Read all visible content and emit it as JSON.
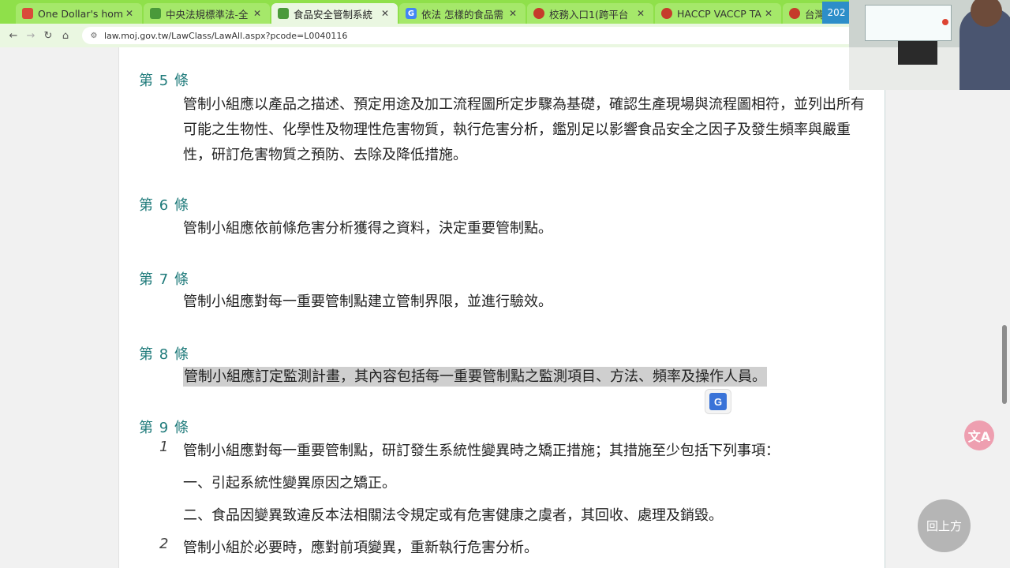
{
  "tabs": [
    {
      "title": "One Dollar's hom",
      "favicon": "red-square-icon",
      "color": "#d94a3a",
      "active": false
    },
    {
      "title": "中央法規標準法-全",
      "favicon": "green-leaf-icon",
      "color": "#4a9a3a",
      "active": false
    },
    {
      "title": "食品安全管制系統",
      "favicon": "green-leaf-icon",
      "color": "#4a9a3a",
      "active": true
    },
    {
      "title": "依法 怎樣的食品需",
      "favicon": "google-g-icon",
      "color": "#4285f4",
      "active": false
    },
    {
      "title": "校務入口1(跨平台",
      "favicon": "red-circle-icon",
      "color": "#c53b2b",
      "active": false
    },
    {
      "title": "HACCP VACCP TA",
      "favicon": "red-circle-icon",
      "color": "#c53b2b",
      "active": false
    },
    {
      "title": "台灣通",
      "favicon": "red-circle-icon",
      "color": "#c53b2b",
      "active": false
    }
  ],
  "url": "law.moj.gov.tw/LawClass/LawAll.aspx?pcode=L0040116",
  "date_badge": "202",
  "articles": [
    {
      "no": "第 5 條",
      "text": "管制小組應以產品之描述、預定用途及加工流程圖所定步驟為基礎，確認生產現場與流程圖相符，並列出所有可能之生物性、化學性及物理性危害物質，執行危害分析，鑑別足以影響食品安全之因子及發生頻率與嚴重性，研訂危害物質之預防、去除及降低措施。"
    },
    {
      "no": "第 6 條",
      "text": "管制小組應依前條危害分析獲得之資料，決定重要管制點。"
    },
    {
      "no": "第 7 條",
      "text": "管制小組應對每一重要管制點建立管制界限，並進行驗效。"
    },
    {
      "no": "第 8 條",
      "text": "管制小組應訂定監測計畫，其內容包括每一重要管制點之監測項目、方法、頻率及操作人員。"
    },
    {
      "no": "第 9 條",
      "items": [
        {
          "num": "1",
          "text": "管制小組應對每一重要管制點，研訂發生系統性變異時之矯正措施；其措施至少包括下列事項："
        },
        {
          "num": "",
          "text": "一、引起系統性變異原因之矯正。"
        },
        {
          "num": "",
          "text": "二、食品因變異致違反本法相關法令規定或有危害健康之虞者，其回收、處理及銷毀。"
        },
        {
          "num": "2",
          "text": "管制小組於必要時，應對前項變異，重新執行危害分析。"
        }
      ]
    }
  ],
  "back_to_top_label": "回上方",
  "translate_label": "G",
  "a11y_label": "文A"
}
